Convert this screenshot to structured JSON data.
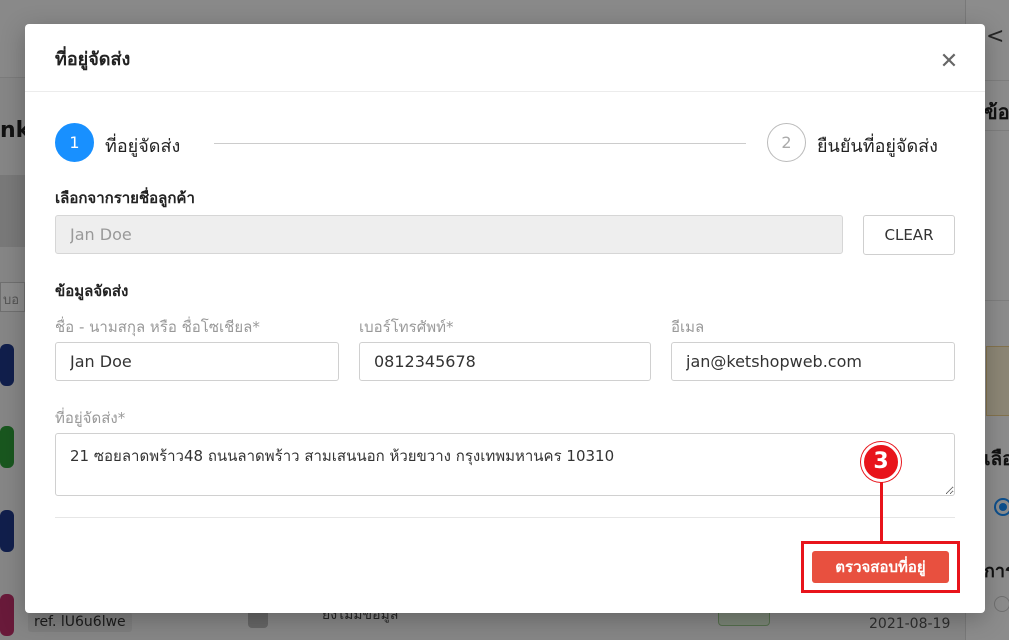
{
  "background": {
    "left_title": "nk",
    "search_hint": "บอ",
    "ref_label": "ref. lU6u6lwe",
    "mid_text": "ยังไม่มีข้อมูล",
    "date": "2021-08-19",
    "right_chevron": "<",
    "right_heading": "ข้อ",
    "right_select_label": "เลือ",
    "right_section_label": "การ"
  },
  "modal": {
    "title": "ที่อยู่จัดส่ง",
    "close_icon": "close-icon",
    "stepper": {
      "steps": [
        {
          "number": "1",
          "label": "ที่อยู่จัดส่ง",
          "active": true
        },
        {
          "number": "2",
          "label": "ยืนยันที่อยู่จัดส่ง",
          "active": false
        }
      ]
    },
    "customer_select": {
      "label": "เลือกจากรายชื่อลูกค้า",
      "value": "Jan Doe",
      "clear_button": "CLEAR"
    },
    "shipping": {
      "section_label": "ข้อมูลจัดส่ง",
      "name_label": "ชื่อ - นามสกุล หรือ ชื่อโซเชียล*",
      "name_value": "Jan Doe",
      "phone_label": "เบอร์โทรศัพท์*",
      "phone_value": "0812345678",
      "email_label": "อีเมล",
      "email_value": "jan@ketshopweb.com",
      "address_label": "ที่อยู่จัดส่ง*",
      "address_value": "21 ซอยลาดพร้าว48 ถนนลาดพร้าว สามเสนนอก ห้วยขวาง กรุงเทพมหานคร 10310"
    },
    "verify_button": "ตรวจสอบที่อยู่"
  },
  "annotation": {
    "step_number": "3",
    "color": "#e8141b"
  },
  "colors": {
    "primary": "#1890ff",
    "action": "#e8503f"
  }
}
